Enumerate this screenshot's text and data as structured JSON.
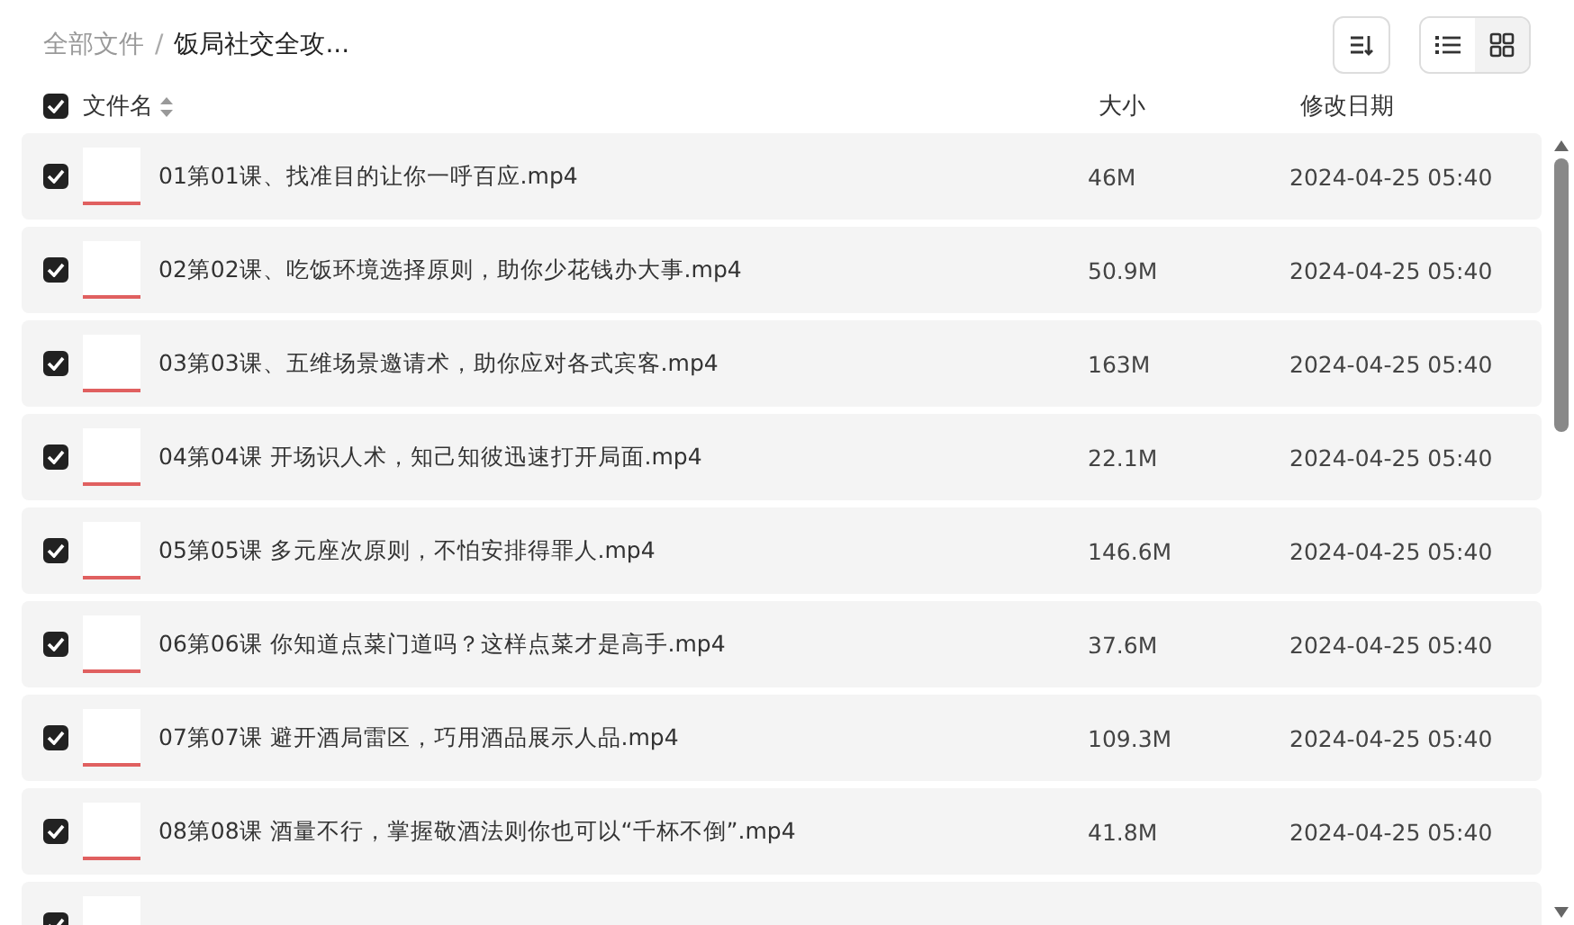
{
  "breadcrumb": [
    {
      "label": "全部文件",
      "current": false
    },
    {
      "label": "饭局社交全攻...",
      "current": true
    }
  ],
  "breadcrumb_separator": "/",
  "view_toggle": [
    {
      "kind": "list",
      "selected": true
    },
    {
      "kind": "grid",
      "selected": false
    }
  ],
  "table": {
    "select_all_checked": true,
    "columns": [
      "文件名",
      "大小",
      "修改日期"
    ],
    "rows": [
      {
        "checked": true,
        "name": "01第01课、找准目的让你一呼百应.mp4",
        "size": "46M",
        "modified": "2024-04-25 05:40"
      },
      {
        "checked": true,
        "name": "02第02课、吃饭环境选择原则，助你少花钱办大事.mp4",
        "size": "50.9M",
        "modified": "2024-04-25 05:40"
      },
      {
        "checked": true,
        "name": "03第03课、五维场景邀请术，助你应对各式宾客.mp4",
        "size": "163M",
        "modified": "2024-04-25 05:40"
      },
      {
        "checked": true,
        "name": "04第04课 开场识人术，知己知彼迅速打开局面.mp4",
        "size": "22.1M",
        "modified": "2024-04-25 05:40"
      },
      {
        "checked": true,
        "name": "05第05课 多元座次原则，不怕安排得罪人.mp4",
        "size": "146.6M",
        "modified": "2024-04-25 05:40"
      },
      {
        "checked": true,
        "name": "06第06课 你知道点菜门道吗？这样点菜才是高手.mp4",
        "size": "37.6M",
        "modified": "2024-04-25 05:40"
      },
      {
        "checked": true,
        "name": "07第07课 避开酒局雷区，巧用酒品展示人品.mp4",
        "size": "109.3M",
        "modified": "2024-04-25 05:40"
      },
      {
        "checked": true,
        "name": "08第08课 酒量不行，掌握敬酒法则你也可以“千杯不倒”.mp4",
        "size": "41.8M",
        "modified": "2024-04-25 05:40"
      },
      {
        "checked": true
      }
    ]
  }
}
